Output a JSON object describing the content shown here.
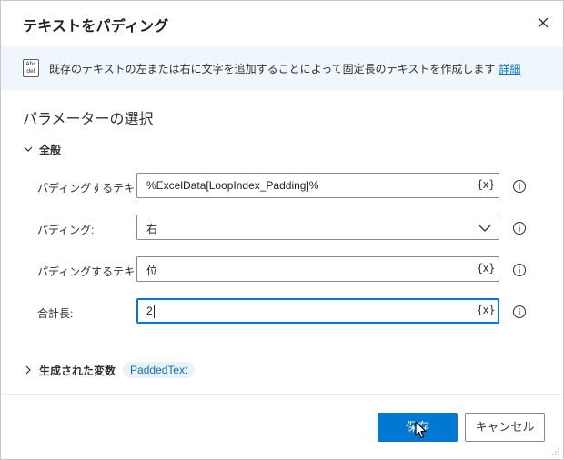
{
  "dialog": {
    "title": "テキストをパディング"
  },
  "banner": {
    "icon_text_1": "Abc",
    "icon_text_2": "def",
    "description": "既存のテキストの左または右に文字を追加することによって固定長のテキストを作成します",
    "link": "詳細"
  },
  "parameters": {
    "heading": "パラメーターの選択",
    "section": "全般",
    "rows": [
      {
        "label": "パディングするテキスト:",
        "value": "%ExcelData[LoopIndex_Padding]%",
        "kind": "text",
        "var_button": "{x}"
      },
      {
        "label": "パディング:",
        "value": "右",
        "kind": "dropdown"
      },
      {
        "label": "パディングするテキスト:",
        "value": "位",
        "kind": "text",
        "var_button": "{x}"
      },
      {
        "label": "合計長:",
        "value": "2",
        "kind": "text",
        "var_button": "{x}"
      }
    ]
  },
  "outputs": {
    "label": "生成された変数",
    "variable": "PaddedText"
  },
  "footer": {
    "save_label": "保存",
    "cancel_label": "キャンセル"
  },
  "colors": {
    "primary": "#0078d4",
    "banner_bg": "#eff6fc",
    "chip_bg": "#e8f2fb"
  }
}
